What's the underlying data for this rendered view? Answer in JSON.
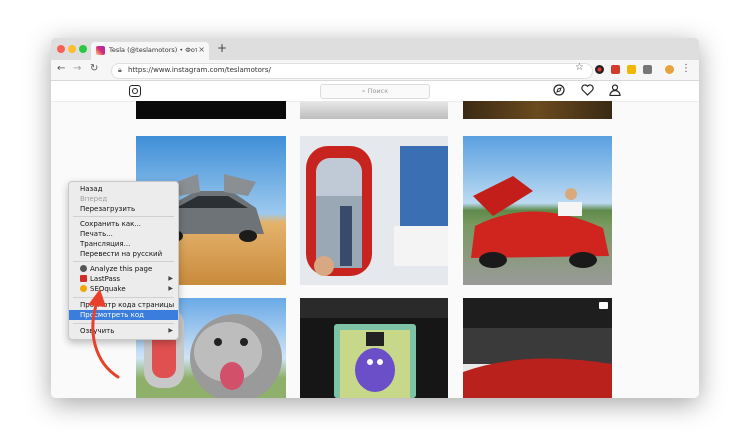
{
  "browser": {
    "tab_title": "Tesla (@teslamotors) • Фото и",
    "tab_close": "×",
    "new_tab": "+",
    "url": "https://www.instagram.com/teslamotors/",
    "nav": {
      "back": "←",
      "forward": "→",
      "reload": "↻"
    },
    "star": "☆",
    "menu": "⋮"
  },
  "instagram": {
    "search_placeholder": "Поиск"
  },
  "context_menu": {
    "items": [
      {
        "label": "Назад",
        "disabled": false
      },
      {
        "label": "Вперед",
        "disabled": true
      },
      {
        "label": "Перезагрузить",
        "disabled": false
      },
      {
        "label": "Сохранить как...",
        "disabled": false
      },
      {
        "label": "Печать...",
        "disabled": false
      },
      {
        "label": "Трансляция...",
        "disabled": false
      },
      {
        "label": "Перевести на русский",
        "disabled": false
      },
      {
        "label": "Analyze this page",
        "disabled": false
      },
      {
        "label": "LastPass",
        "disabled": false
      },
      {
        "label": "SEOquake",
        "disabled": false
      },
      {
        "label": "Просмотр кода страницы",
        "disabled": false
      },
      {
        "label": "Просмотреть код",
        "disabled": false,
        "highlighted": true
      },
      {
        "label": "Озвучить",
        "disabled": false
      }
    ]
  },
  "colors": {
    "accent_highlight": "#3b7ddd",
    "arrow_annotation": "#e8402a"
  }
}
